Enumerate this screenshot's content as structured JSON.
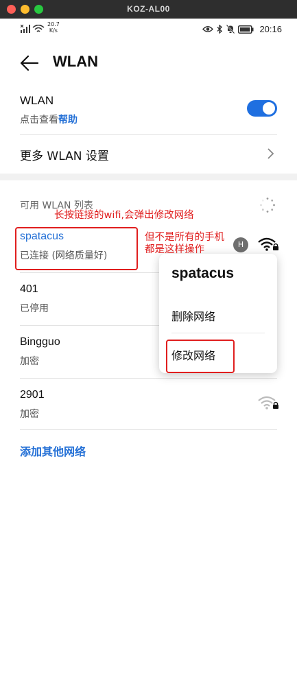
{
  "window": {
    "title": "KOZ-AL00"
  },
  "status_bar": {
    "net_speed_value": "20.7",
    "net_speed_unit": "K/s",
    "time": "20:16"
  },
  "header": {
    "title": "WLAN"
  },
  "wlan_toggle": {
    "label": "WLAN",
    "sub_prefix": "点击查看",
    "help_link": "帮助",
    "enabled": true,
    "accent_color": "#1f6fe0"
  },
  "more_settings": {
    "label": "更多 WLAN 设置"
  },
  "network_list": {
    "header": "可用 WLAN 列表",
    "items": [
      {
        "name": "spatacus",
        "status": "已连接 (网络质量好)",
        "connected": true,
        "avatar": "H"
      },
      {
        "name": "401",
        "status": "已停用"
      },
      {
        "name": "Bingguo",
        "status": "加密"
      },
      {
        "name": "2901",
        "status": "加密"
      }
    ],
    "add_other": "添加其他网络"
  },
  "context_menu": {
    "title": "spatacus",
    "items": [
      "删除网络",
      "修改网络"
    ]
  },
  "annotations": {
    "note1": "长按链接的wifi,会弹出修改网络",
    "note2_line1": "但不是所有的手机",
    "note2_line2": "都是这样操作",
    "color": "#e01e1e"
  },
  "icons": [
    "back-arrow-icon",
    "chevron-right-icon",
    "loading-spinner-icon",
    "wifi-locked-icon",
    "signal-icon",
    "eye-icon",
    "bluetooth-icon",
    "mute-bell-icon",
    "battery-icon"
  ]
}
